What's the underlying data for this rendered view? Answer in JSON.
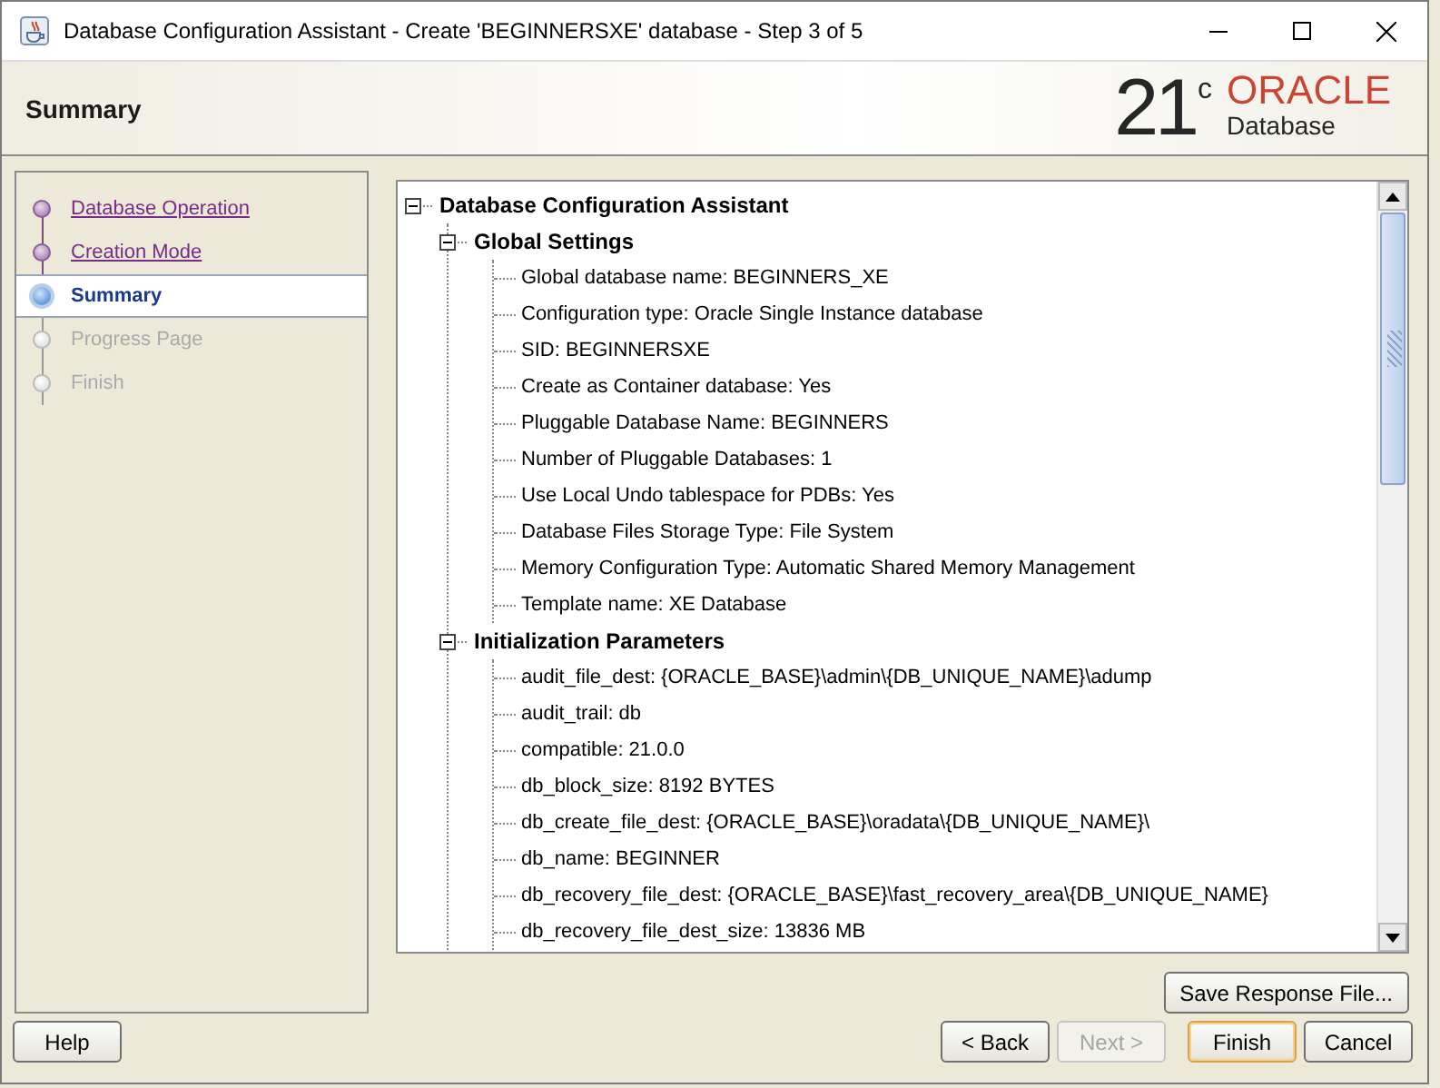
{
  "window": {
    "title": "Database Configuration Assistant - Create 'BEGINNERSXE' database - Step 3 of 5"
  },
  "header": {
    "title": "Summary",
    "logo": {
      "version": "21",
      "superscript": "c",
      "brand": "ORACLE",
      "product": "Database"
    }
  },
  "steps": [
    {
      "label": "Database Operation",
      "visited": true,
      "selected": false,
      "disabled": false
    },
    {
      "label": "Creation Mode",
      "visited": true,
      "selected": false,
      "disabled": false
    },
    {
      "label": "Summary",
      "visited": false,
      "selected": true,
      "disabled": false
    },
    {
      "label": "Progress Page",
      "visited": false,
      "selected": false,
      "disabled": true
    },
    {
      "label": "Finish",
      "visited": false,
      "selected": false,
      "disabled": true
    }
  ],
  "summary_tree": {
    "label": "Database Configuration Assistant",
    "expanded": true,
    "children": [
      {
        "label": "Global Settings",
        "expanded": true,
        "children": [
          {
            "label": "Global database name: BEGINNERS_XE"
          },
          {
            "label": "Configuration type: Oracle Single Instance database"
          },
          {
            "label": "SID: BEGINNERSXE"
          },
          {
            "label": "Create as Container database: Yes"
          },
          {
            "label": "Pluggable Database Name: BEGINNERS"
          },
          {
            "label": "Number of Pluggable Databases: 1"
          },
          {
            "label": "Use Local Undo tablespace for PDBs: Yes"
          },
          {
            "label": "Database Files Storage Type: File System"
          },
          {
            "label": "Memory Configuration Type: Automatic Shared Memory Management"
          },
          {
            "label": "Template name: XE Database"
          }
        ]
      },
      {
        "label": "Initialization Parameters",
        "expanded": true,
        "children": [
          {
            "label": "audit_file_dest: {ORACLE_BASE}\\admin\\{DB_UNIQUE_NAME}\\adump"
          },
          {
            "label": "audit_trail: db"
          },
          {
            "label": "compatible: 21.0.0"
          },
          {
            "label": "db_block_size: 8192 BYTES"
          },
          {
            "label": "db_create_file_dest: {ORACLE_BASE}\\oradata\\{DB_UNIQUE_NAME}\\"
          },
          {
            "label": "db_name: BEGINNER"
          },
          {
            "label": "db_recovery_file_dest: {ORACLE_BASE}\\fast_recovery_area\\{DB_UNIQUE_NAME}"
          },
          {
            "label": "db_recovery_file_dest_size: 13836 MB"
          }
        ]
      }
    ]
  },
  "save_button": {
    "label": "Save Response File...",
    "disabled": false,
    "default": false
  },
  "footer_buttons": [
    {
      "label": "Help",
      "disabled": false,
      "default": false
    },
    {
      "label": "< Back",
      "disabled": false,
      "default": false
    },
    {
      "label": "Next >",
      "disabled": true,
      "default": false
    },
    {
      "label": "Finish",
      "disabled": false,
      "default": true
    },
    {
      "label": "Cancel",
      "disabled": false,
      "default": false
    }
  ]
}
